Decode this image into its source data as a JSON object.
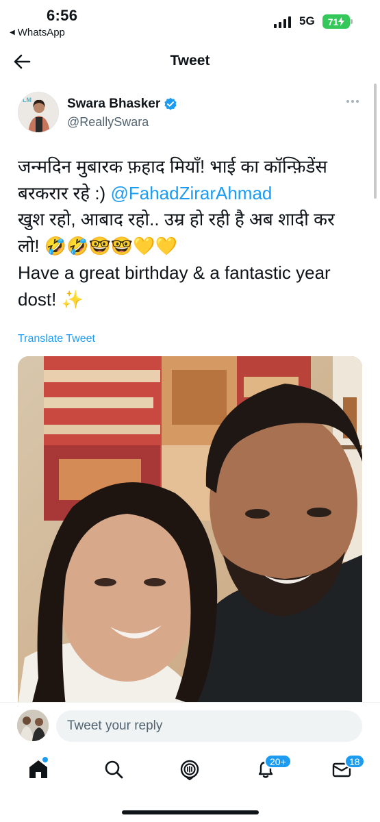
{
  "status_bar": {
    "time": "6:56",
    "back_app": "WhatsApp",
    "network": "5G",
    "battery": "71"
  },
  "header": {
    "title": "Tweet"
  },
  "tweet": {
    "author_name": "Swara Bhasker",
    "author_handle": "@ReallySwara",
    "lines": {
      "l1": "जन्मदिन मुबारक फ़हाद मियाँ! भाई का कॉन्फ़िडेंस",
      "l2_text": "बरकरार रहे :) ",
      "l2_mention": "@FahadZirarAhmad",
      "l3": "खुश रहो, आबाद रहो..  उम्र हो रही है अब शादी कर",
      "l4_text": "लो! ",
      "l4_emoji": "🤣🤣🤓🤓💛💛",
      "l5": "Have a great birthday & a fantastic year",
      "l6_text": "dost! ",
      "l6_emoji": "✨"
    },
    "translate_label": "Translate Tweet"
  },
  "reply": {
    "placeholder": "Tweet your reply"
  },
  "bottom_nav": {
    "notifications_badge": "20+",
    "messages_badge": "18"
  },
  "colors": {
    "accent": "#1d9bf0",
    "battery": "#34c759",
    "text": "#0f1419",
    "secondary_text": "#536471"
  }
}
